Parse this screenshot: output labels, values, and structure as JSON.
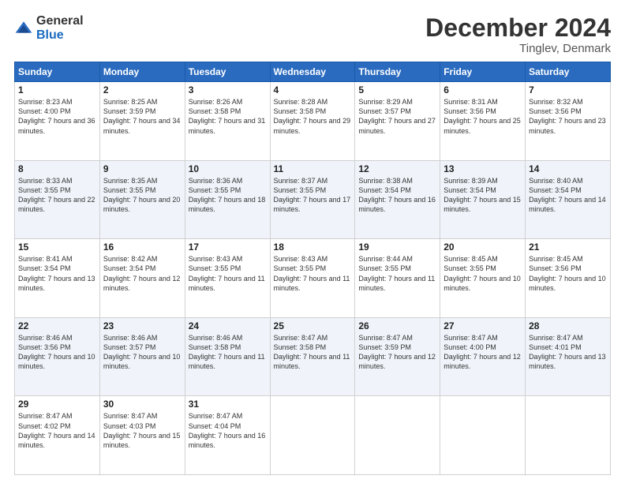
{
  "header": {
    "logo_general": "General",
    "logo_blue": "Blue",
    "month": "December 2024",
    "location": "Tinglev, Denmark"
  },
  "days_of_week": [
    "Sunday",
    "Monday",
    "Tuesday",
    "Wednesday",
    "Thursday",
    "Friday",
    "Saturday"
  ],
  "weeks": [
    [
      {
        "day": "1",
        "sunrise": "Sunrise: 8:23 AM",
        "sunset": "Sunset: 4:00 PM",
        "daylight": "Daylight: 7 hours and 36 minutes."
      },
      {
        "day": "2",
        "sunrise": "Sunrise: 8:25 AM",
        "sunset": "Sunset: 3:59 PM",
        "daylight": "Daylight: 7 hours and 34 minutes."
      },
      {
        "day": "3",
        "sunrise": "Sunrise: 8:26 AM",
        "sunset": "Sunset: 3:58 PM",
        "daylight": "Daylight: 7 hours and 31 minutes."
      },
      {
        "day": "4",
        "sunrise": "Sunrise: 8:28 AM",
        "sunset": "Sunset: 3:58 PM",
        "daylight": "Daylight: 7 hours and 29 minutes."
      },
      {
        "day": "5",
        "sunrise": "Sunrise: 8:29 AM",
        "sunset": "Sunset: 3:57 PM",
        "daylight": "Daylight: 7 hours and 27 minutes."
      },
      {
        "day": "6",
        "sunrise": "Sunrise: 8:31 AM",
        "sunset": "Sunset: 3:56 PM",
        "daylight": "Daylight: 7 hours and 25 minutes."
      },
      {
        "day": "7",
        "sunrise": "Sunrise: 8:32 AM",
        "sunset": "Sunset: 3:56 PM",
        "daylight": "Daylight: 7 hours and 23 minutes."
      }
    ],
    [
      {
        "day": "8",
        "sunrise": "Sunrise: 8:33 AM",
        "sunset": "Sunset: 3:55 PM",
        "daylight": "Daylight: 7 hours and 22 minutes."
      },
      {
        "day": "9",
        "sunrise": "Sunrise: 8:35 AM",
        "sunset": "Sunset: 3:55 PM",
        "daylight": "Daylight: 7 hours and 20 minutes."
      },
      {
        "day": "10",
        "sunrise": "Sunrise: 8:36 AM",
        "sunset": "Sunset: 3:55 PM",
        "daylight": "Daylight: 7 hours and 18 minutes."
      },
      {
        "day": "11",
        "sunrise": "Sunrise: 8:37 AM",
        "sunset": "Sunset: 3:55 PM",
        "daylight": "Daylight: 7 hours and 17 minutes."
      },
      {
        "day": "12",
        "sunrise": "Sunrise: 8:38 AM",
        "sunset": "Sunset: 3:54 PM",
        "daylight": "Daylight: 7 hours and 16 minutes."
      },
      {
        "day": "13",
        "sunrise": "Sunrise: 8:39 AM",
        "sunset": "Sunset: 3:54 PM",
        "daylight": "Daylight: 7 hours and 15 minutes."
      },
      {
        "day": "14",
        "sunrise": "Sunrise: 8:40 AM",
        "sunset": "Sunset: 3:54 PM",
        "daylight": "Daylight: 7 hours and 14 minutes."
      }
    ],
    [
      {
        "day": "15",
        "sunrise": "Sunrise: 8:41 AM",
        "sunset": "Sunset: 3:54 PM",
        "daylight": "Daylight: 7 hours and 13 minutes."
      },
      {
        "day": "16",
        "sunrise": "Sunrise: 8:42 AM",
        "sunset": "Sunset: 3:54 PM",
        "daylight": "Daylight: 7 hours and 12 minutes."
      },
      {
        "day": "17",
        "sunrise": "Sunrise: 8:43 AM",
        "sunset": "Sunset: 3:55 PM",
        "daylight": "Daylight: 7 hours and 11 minutes."
      },
      {
        "day": "18",
        "sunrise": "Sunrise: 8:43 AM",
        "sunset": "Sunset: 3:55 PM",
        "daylight": "Daylight: 7 hours and 11 minutes."
      },
      {
        "day": "19",
        "sunrise": "Sunrise: 8:44 AM",
        "sunset": "Sunset: 3:55 PM",
        "daylight": "Daylight: 7 hours and 11 minutes."
      },
      {
        "day": "20",
        "sunrise": "Sunrise: 8:45 AM",
        "sunset": "Sunset: 3:55 PM",
        "daylight": "Daylight: 7 hours and 10 minutes."
      },
      {
        "day": "21",
        "sunrise": "Sunrise: 8:45 AM",
        "sunset": "Sunset: 3:56 PM",
        "daylight": "Daylight: 7 hours and 10 minutes."
      }
    ],
    [
      {
        "day": "22",
        "sunrise": "Sunrise: 8:46 AM",
        "sunset": "Sunset: 3:56 PM",
        "daylight": "Daylight: 7 hours and 10 minutes."
      },
      {
        "day": "23",
        "sunrise": "Sunrise: 8:46 AM",
        "sunset": "Sunset: 3:57 PM",
        "daylight": "Daylight: 7 hours and 10 minutes."
      },
      {
        "day": "24",
        "sunrise": "Sunrise: 8:46 AM",
        "sunset": "Sunset: 3:58 PM",
        "daylight": "Daylight: 7 hours and 11 minutes."
      },
      {
        "day": "25",
        "sunrise": "Sunrise: 8:47 AM",
        "sunset": "Sunset: 3:58 PM",
        "daylight": "Daylight: 7 hours and 11 minutes."
      },
      {
        "day": "26",
        "sunrise": "Sunrise: 8:47 AM",
        "sunset": "Sunset: 3:59 PM",
        "daylight": "Daylight: 7 hours and 12 minutes."
      },
      {
        "day": "27",
        "sunrise": "Sunrise: 8:47 AM",
        "sunset": "Sunset: 4:00 PM",
        "daylight": "Daylight: 7 hours and 12 minutes."
      },
      {
        "day": "28",
        "sunrise": "Sunrise: 8:47 AM",
        "sunset": "Sunset: 4:01 PM",
        "daylight": "Daylight: 7 hours and 13 minutes."
      }
    ],
    [
      {
        "day": "29",
        "sunrise": "Sunrise: 8:47 AM",
        "sunset": "Sunset: 4:02 PM",
        "daylight": "Daylight: 7 hours and 14 minutes."
      },
      {
        "day": "30",
        "sunrise": "Sunrise: 8:47 AM",
        "sunset": "Sunset: 4:03 PM",
        "daylight": "Daylight: 7 hours and 15 minutes."
      },
      {
        "day": "31",
        "sunrise": "Sunrise: 8:47 AM",
        "sunset": "Sunset: 4:04 PM",
        "daylight": "Daylight: 7 hours and 16 minutes."
      },
      null,
      null,
      null,
      null
    ]
  ]
}
